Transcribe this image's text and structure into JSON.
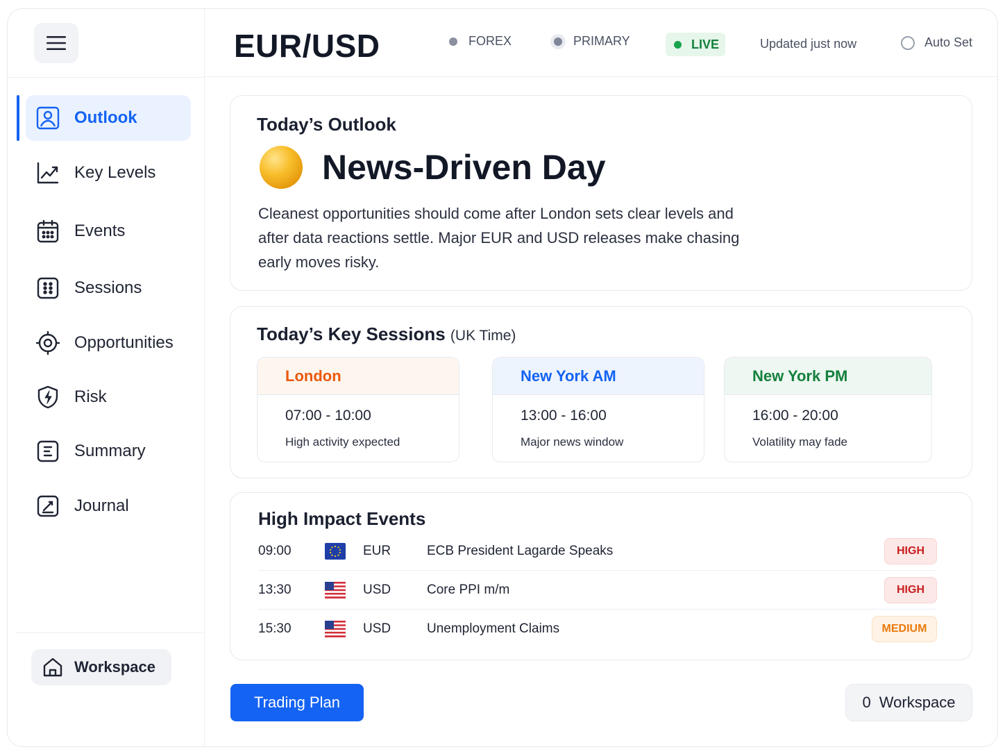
{
  "header": {
    "pair": "EUR/USD",
    "chips": {
      "forex": "FOREX",
      "primary": "PRIMARY",
      "live": "LIVE"
    },
    "updated": "Updated just now",
    "auto_set": "Auto Set"
  },
  "sidebar": {
    "items": [
      {
        "label": "Outlook",
        "icon": "outlook-icon",
        "active": true
      },
      {
        "label": "Key Levels",
        "icon": "chart-line-icon"
      },
      {
        "label": "Events",
        "icon": "calendar-icon"
      },
      {
        "label": "Sessions",
        "icon": "grid-icon"
      },
      {
        "label": "Opportunities",
        "icon": "target-icon"
      },
      {
        "label": "Risk",
        "icon": "shield-bolt-icon"
      },
      {
        "label": "Summary",
        "icon": "summary-icon"
      },
      {
        "label": "Journal",
        "icon": "journal-icon"
      }
    ],
    "workspace_label": "Workspace"
  },
  "outlook": {
    "title": "Today’s Outlook",
    "headline": "News-Driven Day",
    "description": "Cleanest opportunities should come after London sets clear levels and after data reactions settle. Major EUR and USD releases make chasing early moves risky."
  },
  "sessions": {
    "title": "Today’s Key Sessions",
    "subtitle": "(UK Time)",
    "items": [
      {
        "name": "London",
        "time": "07:00 - 10:00",
        "note": "High activity expected",
        "color": "#ea580c"
      },
      {
        "name": "New York AM",
        "time": "13:00 - 16:00",
        "note": "Major news window",
        "color": "#1463f3"
      },
      {
        "name": "New York PM",
        "time": "16:00 - 20:00",
        "note": "Volatility may fade",
        "color": "#15803d"
      }
    ]
  },
  "events": {
    "title": "High Impact Events",
    "rows": [
      {
        "time": "09:00",
        "flag": "eu-flag-icon",
        "currency": "EUR",
        "name": "ECB President Lagarde Speaks",
        "impact": "HIGH"
      },
      {
        "time": "13:30",
        "flag": "us-flag-icon",
        "currency": "USD",
        "name": "Core PPI m/m",
        "impact": "HIGH"
      },
      {
        "time": "15:30",
        "flag": "us-flag-icon",
        "currency": "USD",
        "name": "Unemployment Claims",
        "impact": "MEDIUM"
      }
    ]
  },
  "footer": {
    "trading_plan": "Trading Plan",
    "workspace_count": "0",
    "workspace_label": "Workspace"
  },
  "colors": {
    "accent": "#1463f3",
    "live": "#15803d",
    "high": "#c81e1e",
    "medium": "#ea7a0c"
  }
}
